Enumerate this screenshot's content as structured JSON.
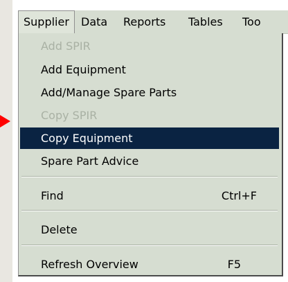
{
  "menubar": {
    "items": [
      {
        "label": "Supplier"
      },
      {
        "label": "Data"
      },
      {
        "label": "Reports"
      },
      {
        "label": "Tables"
      },
      {
        "label": "Too"
      }
    ]
  },
  "dropdown": {
    "items": [
      {
        "label": "Add SPIR",
        "disabled": true
      },
      {
        "label": "Add Equipment"
      },
      {
        "label": "Add/Manage Spare Parts"
      },
      {
        "label": "Copy SPIR",
        "disabled": true
      },
      {
        "label": "Copy Equipment",
        "selected": true
      },
      {
        "label": "Spare Part Advice"
      },
      {
        "label": "Find",
        "shortcut": "Ctrl+F"
      },
      {
        "label": "Delete"
      },
      {
        "label": "Refresh Overview",
        "shortcut": "F5"
      }
    ]
  },
  "colors": {
    "menu_bg": "#d6ddd1",
    "selected_bg": "#0a2342",
    "disabled_text": "#a9b1a4",
    "arrow": "#ff0000"
  }
}
